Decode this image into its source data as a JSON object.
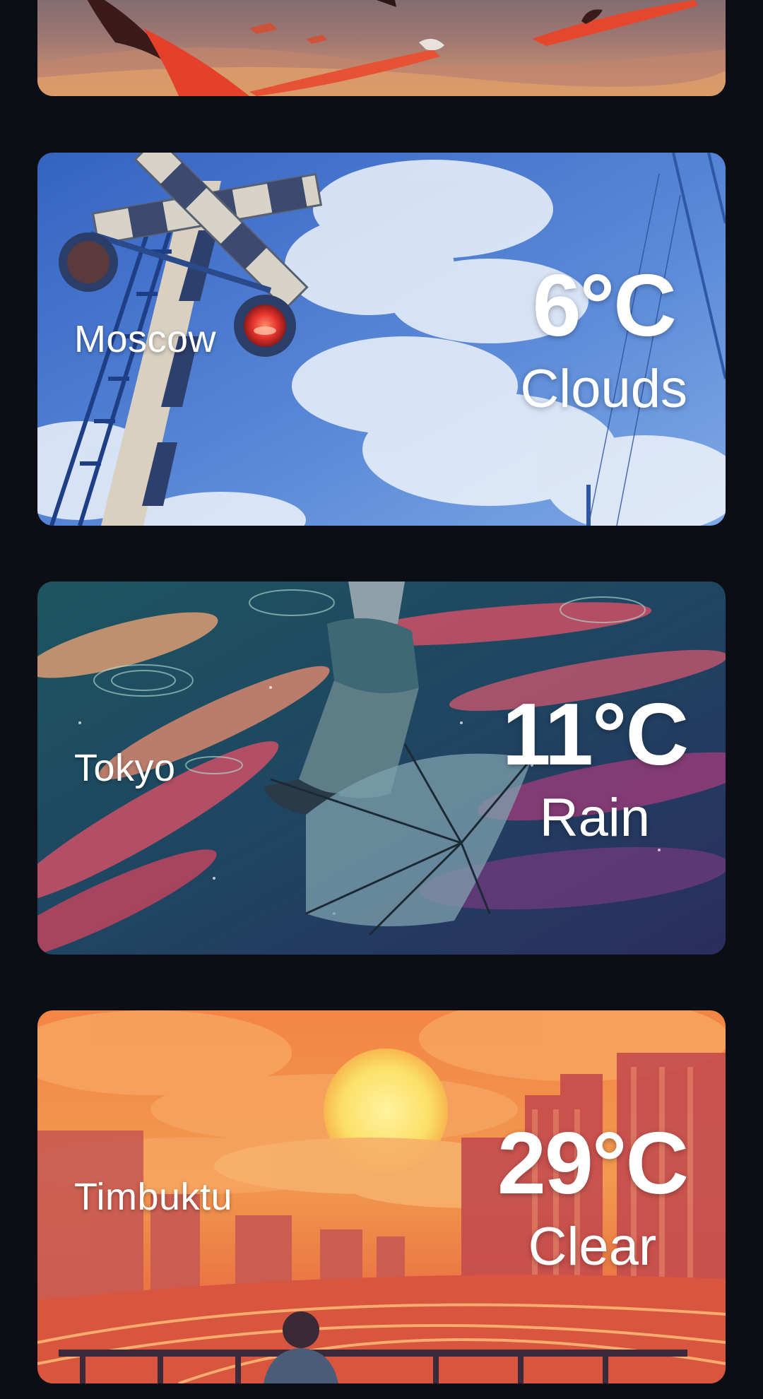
{
  "cards": [
    {
      "city": "",
      "temp": "",
      "condition": "",
      "theme": "flamingo-sunset",
      "colors": {
        "top": "#6a5a6d",
        "bottom": "#c98a6a",
        "accent": "#e0472a"
      }
    },
    {
      "city": "Moscow",
      "temp": "6°C",
      "condition": "Clouds",
      "theme": "railway-crossing-sky",
      "colors": {
        "top": "#3a68c6",
        "bottom": "#6e9ce0",
        "accent": "#e23b2e"
      }
    },
    {
      "city": "Tokyo",
      "temp": "11°C",
      "condition": "Rain",
      "theme": "umbrella-reflection-night",
      "colors": {
        "top": "#1f4d5e",
        "bottom": "#2a2f5c",
        "accent": "#d9506a"
      }
    },
    {
      "city": "Timbuktu",
      "temp": "29°C",
      "condition": "Clear",
      "theme": "city-sunset",
      "colors": {
        "top": "#f07a44",
        "bottom": "#e2593f",
        "accent": "#fbe36a"
      }
    }
  ]
}
